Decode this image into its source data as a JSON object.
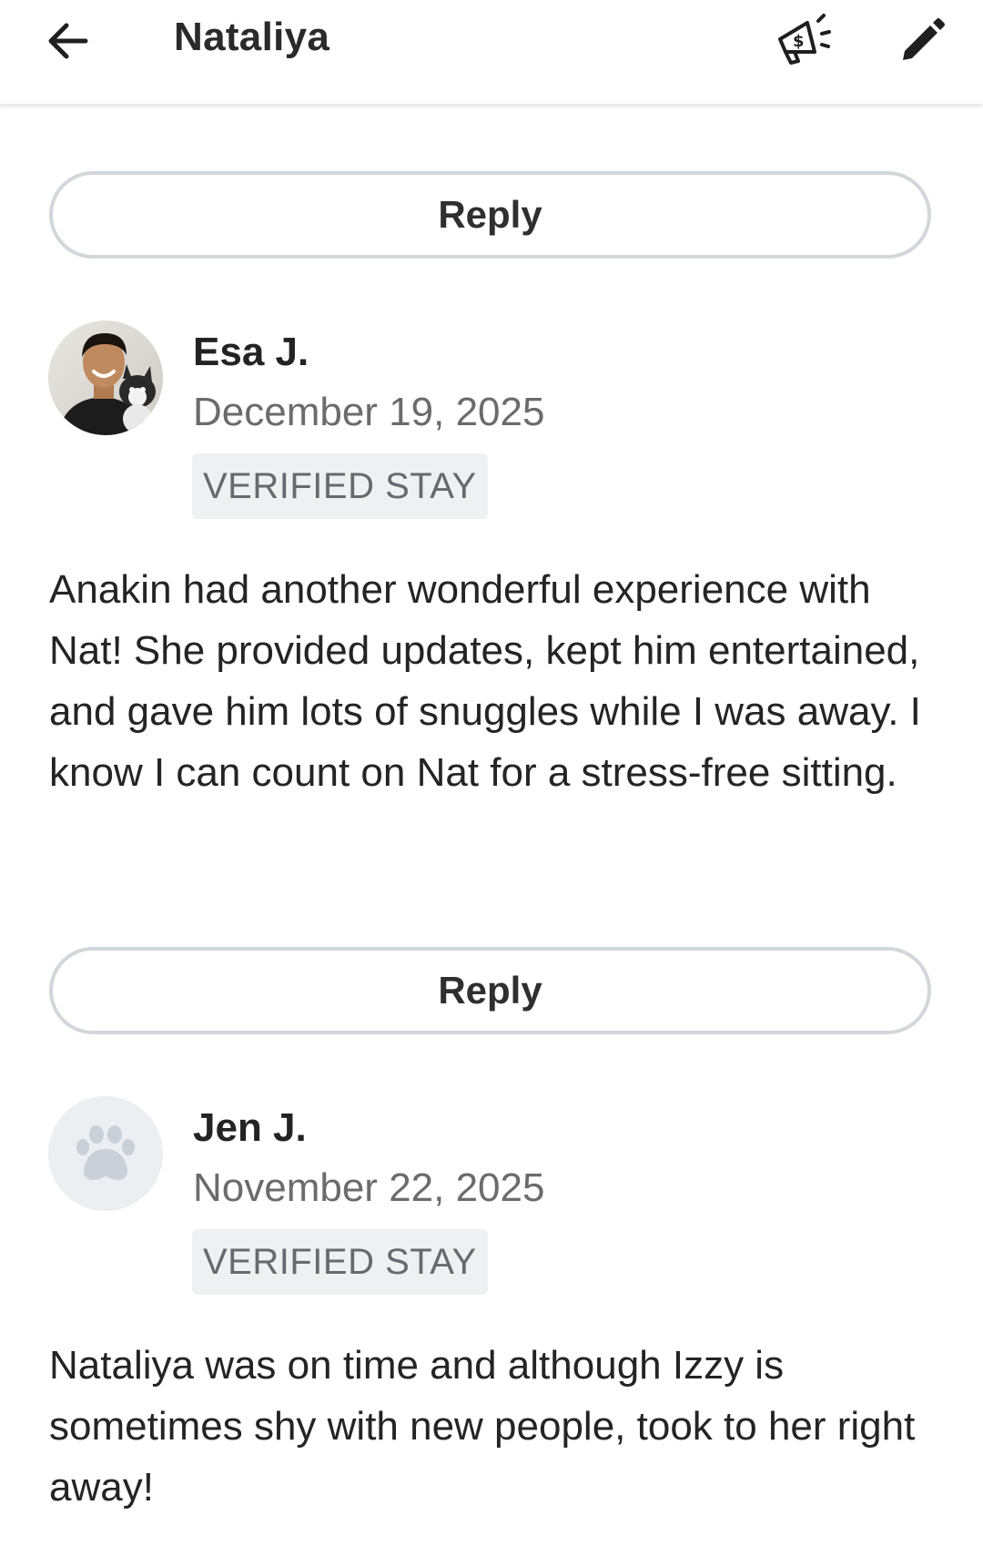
{
  "header": {
    "title": "Nataliya",
    "back_icon": "arrow-left-icon",
    "promo_icon": "megaphone-dollar-icon",
    "edit_icon": "pencil-icon"
  },
  "reply_label": "Reply",
  "reviews": [
    {
      "name": "Esa J.",
      "date": "December 19, 2025",
      "badge": "VERIFIED STAY",
      "text": "Anakin had another wonderful experience with Nat! She provided updates, kept him entertained, and gave him lots of snuggles while I was away. I know I can count on Nat for a stress-free sitting.",
      "avatar": "photo"
    },
    {
      "name": "Jen J.",
      "date": "November 22, 2025",
      "badge": "VERIFIED STAY",
      "text": "Nataliya was on time and although Izzy is sometimes shy with new people, took to her right away!",
      "avatar": "paw-placeholder-icon"
    }
  ],
  "colors": {
    "text": "#242424",
    "muted": "#6b6b6b",
    "badge_bg": "#eff0f2",
    "button_border": "#d3d6db"
  }
}
